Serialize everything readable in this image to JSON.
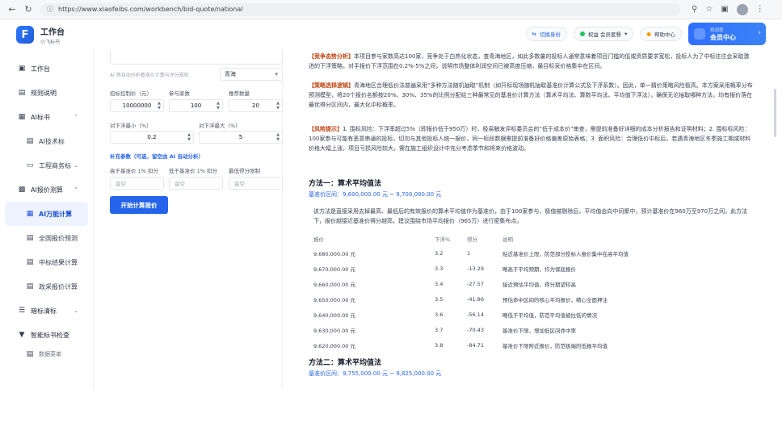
{
  "browser": {
    "url": "https://www.xiaofeibs.com/workbench/bid-quote/national"
  },
  "header": {
    "app_title": "工作台",
    "app_subtitle": "小飞标书",
    "pill_switch": "切换身份",
    "pill_auth": "权益 会员套餐",
    "pill_help": "帮助中心",
    "member_line1": "欢迎您",
    "member_line2": "会员中心"
  },
  "sidebar": {
    "items": [
      {
        "icon": "monitor-icon",
        "label": "工作台"
      },
      {
        "icon": "doc-icon",
        "label": "规则说明"
      },
      {
        "icon": "book-icon",
        "label": "AI标书"
      },
      {
        "icon": "doc-icon",
        "label": "AI技术标"
      },
      {
        "icon": "folder-icon",
        "label": "工程商务标"
      },
      {
        "icon": "calc-icon",
        "label": "AI报价测算"
      },
      {
        "icon": "chart-icon",
        "label": "AI万能计算"
      },
      {
        "icon": "doc-icon",
        "label": "全国报价预测"
      },
      {
        "icon": "doc-icon",
        "label": "中标结果计算"
      },
      {
        "icon": "doc-icon",
        "label": "政采报价计算"
      },
      {
        "icon": "list-icon",
        "label": "暗标清标"
      },
      {
        "icon": "filter-icon",
        "label": "智能标书检查"
      },
      {
        "icon": "doc-icon",
        "label": "数据菜单"
      }
    ]
  },
  "form": {
    "region_label": "AI 将自动分析基准价计算与评分规则",
    "region_value": "青海",
    "ctrl_price_label": "招标控制价（元）",
    "bidders_label": "参与家数",
    "samples_label": "推荐数量",
    "ctrl_price_value": "10000000",
    "bidders_value": "100",
    "samples_value": "20",
    "float_min_label": "对下浮最小（%）",
    "float_max_label": "对下浮最大（%）",
    "float_min_value": "0.2",
    "float_max_value": "5",
    "supplement_label": "补充参数（可选，留空由 AI 自动分析）",
    "above_label": "高于基准价 1% 扣分",
    "below_label": "低于基准价 1% 扣分",
    "min_score_label": "最低得分限制",
    "blank_placeholder": "留空",
    "submit_label": "开始计算报价"
  },
  "content": {
    "para1_tag": "【竞争态势分析】",
    "para1_text": "本项目参与家数高达100家，竞争处于白热化状态，查青海地区，如此多数量的投标人通常意味着项目门槛的低或资质要求宽松，投标人为了中标往往会采取激进的下浮策略。对手报价下浮范围在0.2%-5%之间，说明市场整体利润空间已被高度压缩，最目标采价格集中在区间。",
    "para2_tag": "【策略选择逻辑】",
    "para2_text": "青海地区合理低价法普遍采用“多种方法随机抽取”机制（如开标现场随机抽取基准价计算公式及下浮系数）。因此，单一猜价策略风险极高。本方案采用概率分布预测模型，将20个报价名额按20%、30%、35%的比例分配给三种最常见的基准价计算方法（算术平均法、算数平均法、平均值下浮法），确保无论抽取哪种方法，均有报价落在最优得分区间内，最大化中标概率。",
    "para3_tag": "【风险提示】",
    "para3_text": "1. 围标风险：下浮率超过5%（即报价低于950万）时，极易触发评标委员会的“低于成本价”审查，需提前准备好详细的成本分析报告和证明材料；2. 围标标风险：100家参与可能有恶意串通的投标，切勿与其他投标人统一报价，同一标段数据需提前准备好价格偏差原始表格；3. 面积风险：合理低价中标后，若遇青海地区冬季施工期或材料价格大幅上涨，项目亏损风险较大，需在施工组织设计中充分考虑季节和将来价格波动。",
    "method1_title": "方法一：算术平均值法",
    "method1_range": "基准价区间：9,600,000.00 元 ~ 9,700,000.00 元",
    "method1_desc": "该方法是直接采用去掉最高、最低后的有效报价的算术平均值作为基准价，由于100家参与，极值被剔除后，平均值会向中间聚中，预计基准价在960万至970万之间。此方法下，报价越接近基准价得分越高，建议围绕市场平均报价（965万）进行密集布点。",
    "table_headers": [
      "报价",
      "下浮%",
      "得分",
      "说明"
    ],
    "table_rows": [
      [
        "9,680,000.00 元",
        "3.2",
        "1",
        "贴近基准价上限，防范部分投标人报价集中在高平均值"
      ],
      [
        "9,670,000.00 元",
        "3.3",
        "-13.29",
        "略高于平均预期，作为保底报价"
      ],
      [
        "9,660,000.00 元",
        "3.4",
        "-27.57",
        "接近预估平均值，得分期望较高"
      ],
      [
        "9,650,000.00 元",
        "3.5",
        "-41.86",
        "预估命中区间的核心平均报价，精心全面押注"
      ],
      [
        "9,640,000.00 元",
        "3.6",
        "-56.14",
        "略低于平均值，防范平均值被拉低的情况"
      ],
      [
        "9,630,000.00 元",
        "3.7",
        "-70.43",
        "基准价下限，增加低区间命中率"
      ],
      [
        "9,620,000.00 元",
        "3.8",
        "-84.71",
        "基准价下限附近报价，防范极端的低报平均值"
      ]
    ],
    "method2_title": "方法二：算术平均值法",
    "method2_range": "基准价区间：9,755,000.00 元 ~ 9,825,000.00 元"
  }
}
